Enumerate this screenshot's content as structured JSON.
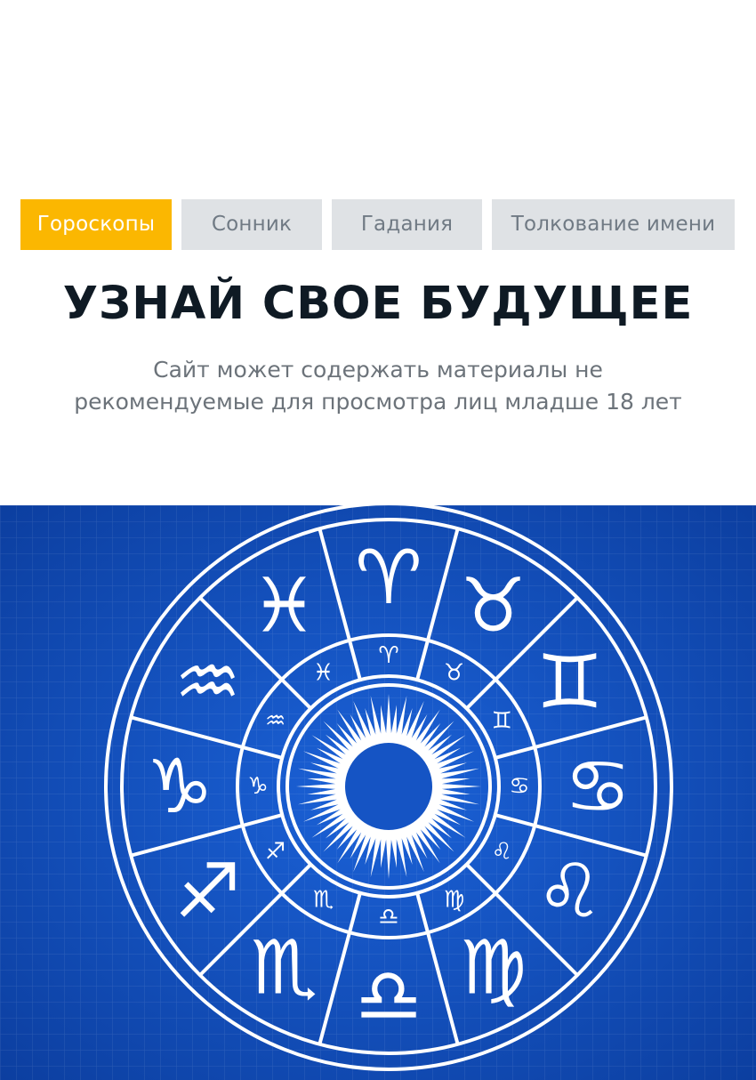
{
  "nav": {
    "tabs": [
      {
        "label": "Гороскопы",
        "active": true
      },
      {
        "label": "Сонник",
        "active": false
      },
      {
        "label": "Гадания",
        "active": false
      },
      {
        "label": "Толкование имени",
        "active": false
      }
    ]
  },
  "headline": {
    "title": "УЗНАЙ СВОЕ БУДУЩЕЕ",
    "subtitle_line1": "Сайт может содержать материалы не",
    "subtitle_line2": "рекомендуемые для просмотра лиц младше 18 лет"
  },
  "hero": {
    "image": "zodiac-wheel",
    "signs": [
      "♈",
      "♉",
      "♊",
      "♋",
      "♌",
      "♍",
      "♎",
      "♏",
      "♐",
      "♑",
      "♒",
      "♓"
    ]
  },
  "colors": {
    "accent": "#fbb701",
    "tab_bg": "#dfe2e5",
    "tab_text": "#707a84",
    "title": "#0f1a24",
    "hero_blue": "#1554c4"
  }
}
